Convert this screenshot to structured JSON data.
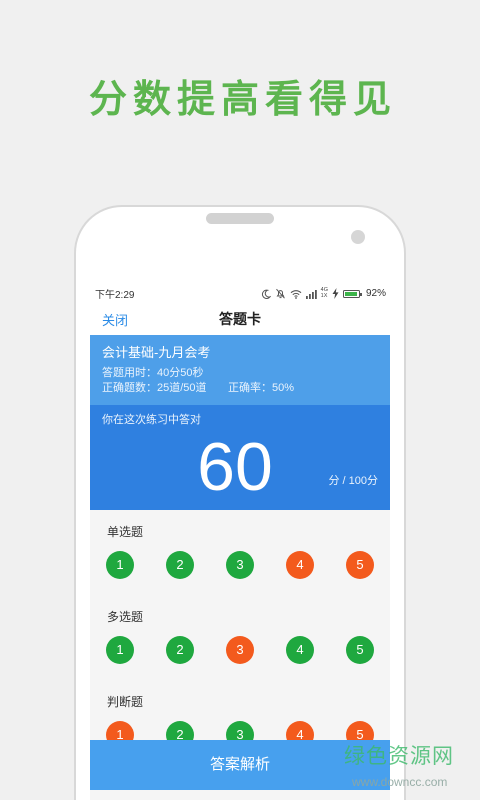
{
  "promo": {
    "headline": "分数提高看得见"
  },
  "status_bar": {
    "time": "下午2:29",
    "network_type_top": "4G",
    "network_type_bottom": "1X",
    "battery": "92%"
  },
  "status_icons": [
    "moon-icon",
    "bell-off-icon",
    "wifi-icon",
    "signal-icon",
    "charging-icon",
    "battery-icon"
  ],
  "header": {
    "close_label": "关闭",
    "title": "答题卡"
  },
  "summary": {
    "exam_name": "会计基础-九月会考",
    "time_used": "答题用时：40分50秒",
    "correct_count": "正确题数：25道/50道",
    "accuracy": "正确率：50%",
    "score_caption": "你在这次练习中答对",
    "score": "60",
    "score_unit": "分 / 100分"
  },
  "sections": [
    {
      "label": "单选题",
      "questions": [
        {
          "number": "1",
          "status": "correct"
        },
        {
          "number": "2",
          "status": "correct"
        },
        {
          "number": "3",
          "status": "correct"
        },
        {
          "number": "4",
          "status": "wrong"
        },
        {
          "number": "5",
          "status": "wrong"
        }
      ]
    },
    {
      "label": "多选题",
      "questions": [
        {
          "number": "1",
          "status": "correct"
        },
        {
          "number": "2",
          "status": "correct"
        },
        {
          "number": "3",
          "status": "wrong"
        },
        {
          "number": "4",
          "status": "correct"
        },
        {
          "number": "5",
          "status": "correct"
        }
      ]
    },
    {
      "label": "判断题",
      "questions": [
        {
          "number": "1",
          "status": "wrong"
        },
        {
          "number": "2",
          "status": "correct"
        },
        {
          "number": "3",
          "status": "correct"
        },
        {
          "number": "4",
          "status": "wrong"
        },
        {
          "number": "5",
          "status": "wrong"
        }
      ]
    }
  ],
  "footer": {
    "analysis_button": "答案解析"
  },
  "watermark": {
    "name": "绿色资源网",
    "url": "www.downcc.com"
  },
  "colors": {
    "headline_green": "#5db54f",
    "accent_blue": "#2b8be6",
    "card_top": "#4e9fe9",
    "card_bottom": "#2f80e0",
    "correct": "#1fa83f",
    "wrong": "#f35a1d",
    "button_blue": "#47a0ee",
    "battery_green": "#3cb44a",
    "watermark_green": "#3cba6b"
  }
}
